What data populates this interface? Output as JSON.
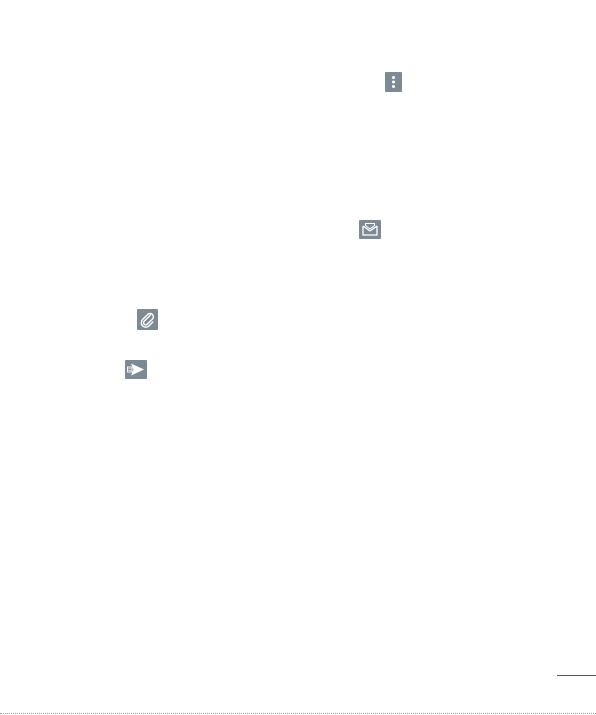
{
  "icons": [
    {
      "id": "menu",
      "name": "more-options-icon",
      "glyph": "vertical-dots"
    },
    {
      "id": "mail",
      "name": "mail-icon",
      "glyph": "envelope-open"
    },
    {
      "id": "attach",
      "name": "attach-icon",
      "glyph": "paperclip"
    },
    {
      "id": "send",
      "name": "send-icon",
      "glyph": "paper-plane-send"
    }
  ],
  "colors": {
    "icon_background": "#7d8a93",
    "icon_foreground": "#ffffff",
    "page_background": "#ffffff"
  }
}
